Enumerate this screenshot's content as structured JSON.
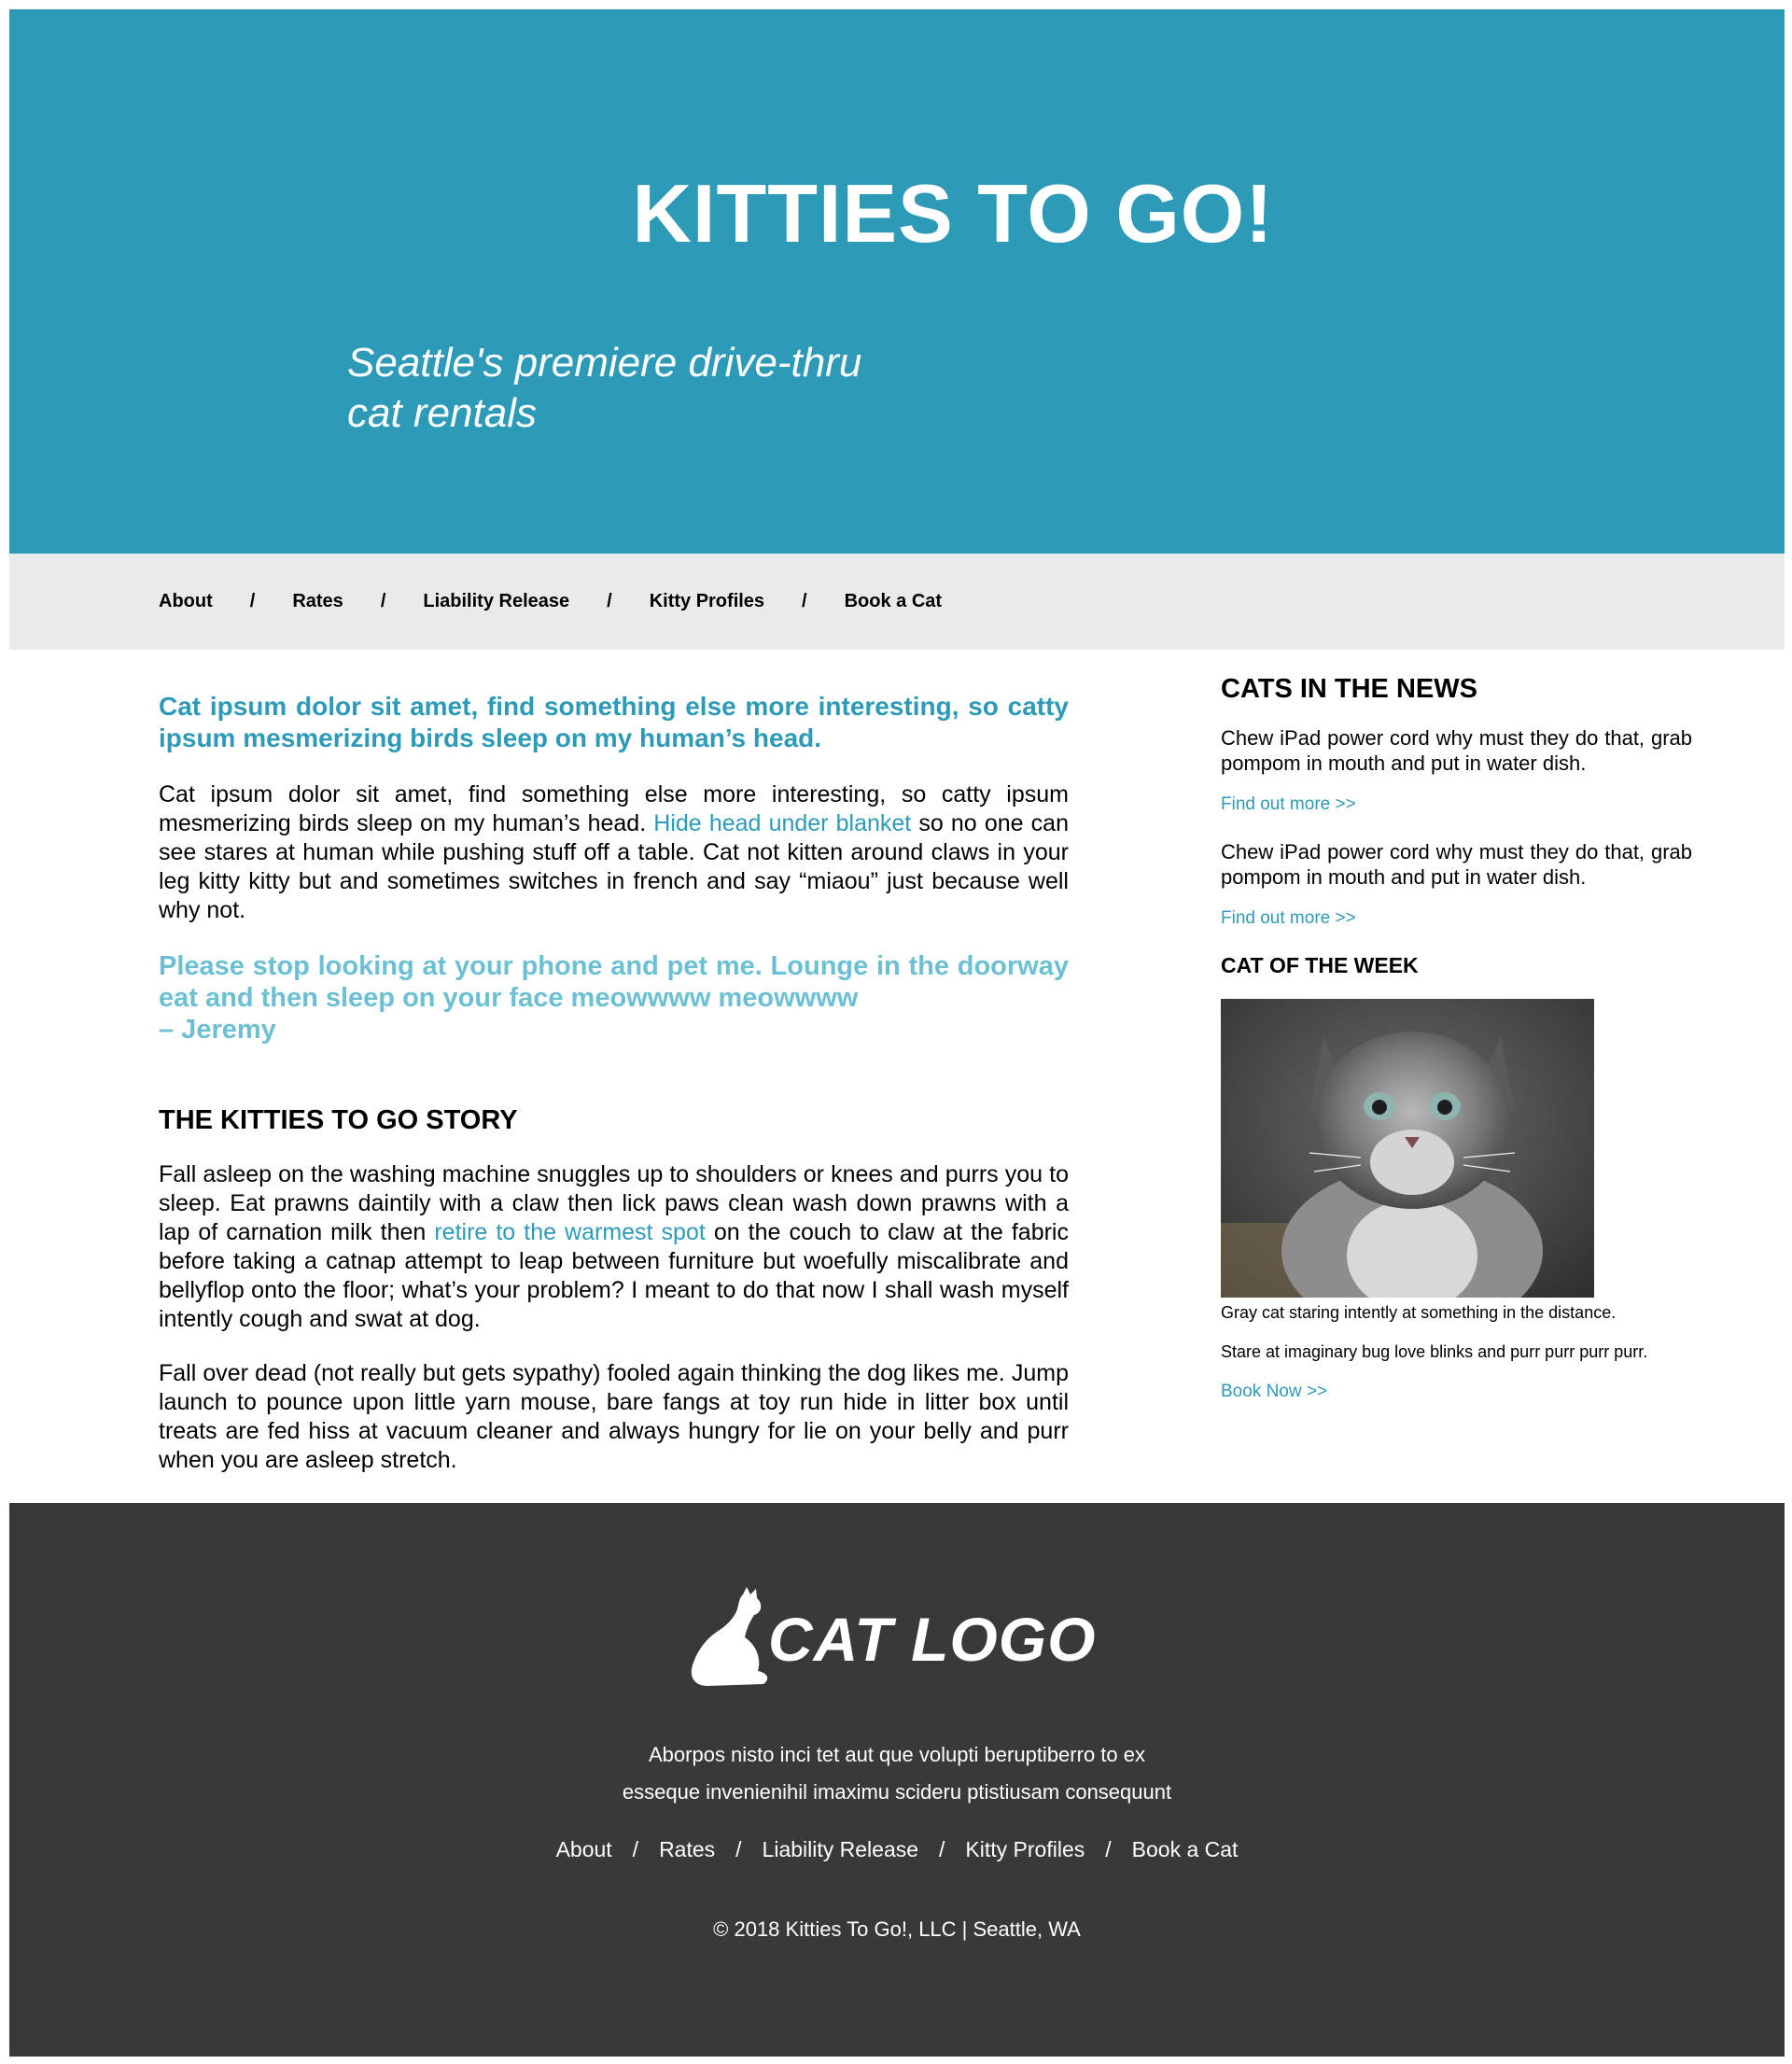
{
  "hero": {
    "title": "KITTIES TO GO!",
    "tagline_line1": "Seattle's premiere drive-thru",
    "tagline_line2": "cat rentals",
    "color": "#2d9bb7"
  },
  "nav": {
    "items": [
      "About",
      "Rates",
      "Liability Release",
      "Kitty Profiles",
      "Book a Cat"
    ],
    "separator": "/"
  },
  "main": {
    "lead": "Cat ipsum dolor sit amet, find something else more interesting, so catty ipsum mesmerizing birds sleep on my human’s head.",
    "intro_p1_before": "Cat ipsum dolor sit amet, find something else more interesting, so catty ipsum mesmerizing birds sleep on my human’s head. ",
    "intro_p1_link": "Hide head under blanket",
    "intro_p1_after": " so no one can see stares at human while pushing stuff off a table. Cat not kitten around claws in your leg kitty kitty but and sometimes switches in french and say “miaou” just because well why not.",
    "quote": "Please stop looking at your phone and pet me. Lounge in the doorway eat and then sleep on your face meowwww meowwww",
    "quote_author": "– Jeremy",
    "story_heading": "THE KITTIES TO GO STORY",
    "story_p1_before": "Fall asleep on the washing machine snuggles up to shoulders or knees and purrs you to sleep. Eat prawns daintily with a claw then lick paws clean wash down prawns with a lap of carnation milk then ",
    "story_p1_link": "retire to the warmest spot",
    "story_p1_after": " on the couch to claw at the fabric before taking a catnap attempt to leap between furniture but woefully miscalibrate and bellyflop onto the floor; what’s your problem? I meant to do that now I shall wash myself intently cough and swat at dog.",
    "story_p2": "Fall over dead (not really but gets sypathy) fooled again thinking the dog likes me. Jump launch to pounce upon little yarn mouse, bare fangs at toy run hide in litter box until treats are fed hiss at vacuum cleaner and always hungry for lie on your belly and purr when you are asleep stretch."
  },
  "sidebar": {
    "news_heading": "CATS IN THE NEWS",
    "news": [
      {
        "text": "Chew iPad power cord why must they do that, grab pompom in mouth and put in water dish.",
        "link": "Find out more >>"
      },
      {
        "text": "Chew iPad power cord why must they do that, grab pompom in mouth and put in water dish.",
        "link": "Find out more >>"
      }
    ],
    "cotw_heading": "CAT OF THE WEEK",
    "cotw_caption": "Gray cat staring intently at something in the distance.",
    "cotw_text": "Stare at imaginary bug love blinks and purr purr purr purr.",
    "cotw_link": "Book Now >>"
  },
  "footer": {
    "logo_text": "CAT LOGO",
    "blurb_line1": "Aborpos nisto inci tet aut que volupti beruptiberro to ex",
    "blurb_line2": "esseque invenienihil imaximu scideru ptistiusam consequunt",
    "nav": [
      "About",
      "Rates",
      "Liability Release",
      "Kitty Profiles",
      "Book a Cat"
    ],
    "separator": "/",
    "copyright": "© 2018 Kitties To Go!, LLC | Seattle, WA",
    "color": "#393939"
  }
}
